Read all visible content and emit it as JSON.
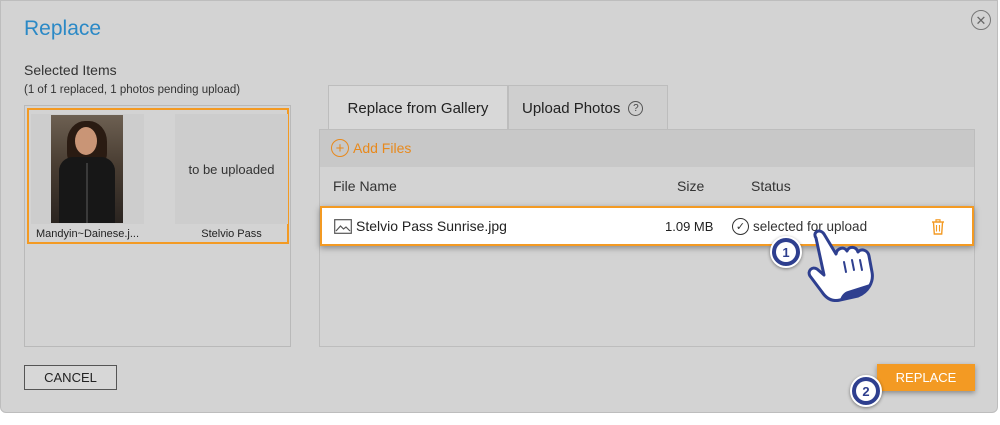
{
  "dialog": {
    "title": "Replace",
    "close_icon": "close-icon"
  },
  "selected": {
    "title": "Selected Items",
    "subtitle": "(1 of 1 replaced, 1 photos pending upload)",
    "items": [
      {
        "caption": "Mandyin~Dainese.j..."
      },
      {
        "caption": "Stelvio Pass",
        "placeholder": "to be uploaded"
      }
    ]
  },
  "tabs": [
    {
      "label": "Replace from Gallery"
    },
    {
      "label": "Upload Photos"
    }
  ],
  "upload": {
    "add_files": "Add Files",
    "columns": {
      "name": "File Name",
      "size": "Size",
      "status": "Status"
    },
    "files": [
      {
        "name": "Stelvio Pass Sunrise.jpg",
        "size": "1.09 MB",
        "status": "selected for upload"
      }
    ]
  },
  "buttons": {
    "cancel": "CANCEL",
    "replace": "REPLACE"
  },
  "steps": [
    "1",
    "2"
  ],
  "colors": {
    "accent": "#f39a23",
    "title_blue": "#2b89c6",
    "step_badge": "#2e3f8f",
    "dialog_bg": "#d3d3d3"
  }
}
